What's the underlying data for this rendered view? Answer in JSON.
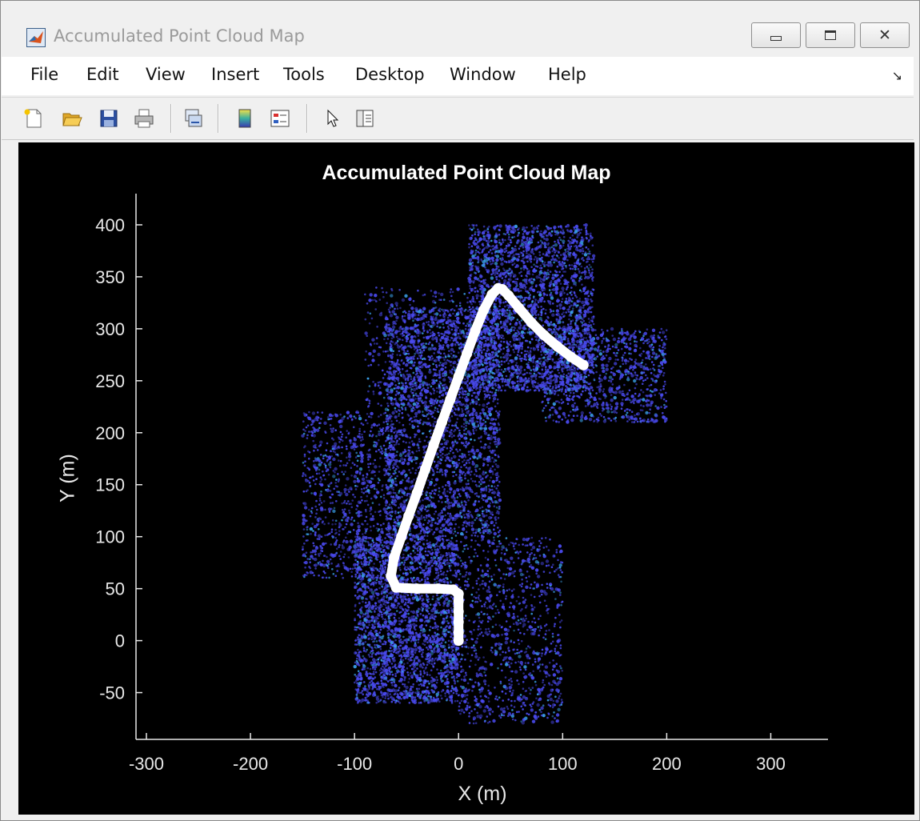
{
  "window": {
    "title": "Accumulated Point Cloud Map",
    "app_icon": "matlab-icon",
    "controls": [
      "minimize-icon",
      "maximize-icon",
      "close-icon"
    ]
  },
  "menu": {
    "items": [
      "File",
      "Edit",
      "View",
      "Insert",
      "Tools",
      "Desktop",
      "Window",
      "Help"
    ],
    "dock_icon": "dock-arrow-icon"
  },
  "toolbar": {
    "buttons": [
      "new-figure-icon",
      "open-file-icon",
      "save-icon",
      "print-icon",
      "link-plot-icon",
      "colorbar-icon",
      "legend-icon",
      "edit-plot-pointer-icon",
      "property-inspector-icon"
    ]
  },
  "colors": {
    "background": "#000000",
    "point_cloud": "#4a4af0",
    "point_cloud_highlight": "#3aa0e8",
    "trajectory": "#ffffff",
    "axis": "#e8e8e8"
  },
  "chart_data": {
    "type": "scatter",
    "title": "Accumulated Point Cloud Map",
    "xlabel": "X (m)",
    "ylabel": "Y (m)",
    "xlim": [
      -310,
      355
    ],
    "ylim": [
      -95,
      430
    ],
    "xticks": [
      -300,
      -200,
      -100,
      0,
      100,
      200,
      300
    ],
    "yticks": [
      -50,
      0,
      50,
      100,
      150,
      200,
      250,
      300,
      350,
      400
    ],
    "xtick_labels": [
      "-300",
      "-200",
      "-100",
      "0",
      "100",
      "200",
      "300"
    ],
    "ytick_labels": [
      "-50",
      "0",
      "50",
      "100",
      "150",
      "200",
      "250",
      "300",
      "350",
      "400"
    ],
    "grid": false,
    "series": [
      {
        "kind": "trajectory",
        "x": [
          0,
          0,
          0,
          0,
          0,
          0,
          -5,
          -20,
          -40,
          -60,
          -65,
          -62,
          -55,
          -48,
          -40,
          -32,
          -24,
          -16,
          -8,
          0,
          8,
          16,
          24,
          32,
          38,
          42,
          48,
          58,
          70,
          82,
          95,
          108,
          120
        ],
        "y": [
          0,
          8,
          18,
          28,
          38,
          45,
          49,
          50,
          50,
          51,
          62,
          80,
          100,
          120,
          142,
          165,
          188,
          210,
          232,
          254,
          276,
          298,
          318,
          333,
          339,
          338,
          332,
          320,
          306,
          294,
          283,
          273,
          265
        ]
      },
      {
        "kind": "point_cloud",
        "regions": [
          {
            "x": [
              -100,
              0
            ],
            "y": [
              -60,
              100
            ],
            "density": "high"
          },
          {
            "x": [
              -70,
              40
            ],
            "y": [
              100,
              320
            ],
            "density": "high"
          },
          {
            "x": [
              10,
              130
            ],
            "y": [
              240,
              400
            ],
            "density": "high"
          },
          {
            "x": [
              80,
              200
            ],
            "y": [
              210,
              300
            ],
            "density": "medium"
          },
          {
            "x": [
              -150,
              -60
            ],
            "y": [
              60,
              220
            ],
            "density": "medium"
          },
          {
            "x": [
              0,
              100
            ],
            "y": [
              -80,
              100
            ],
            "density": "medium"
          },
          {
            "x": [
              -90,
              10
            ],
            "y": [
              220,
              340
            ],
            "density": "low"
          }
        ]
      }
    ]
  }
}
